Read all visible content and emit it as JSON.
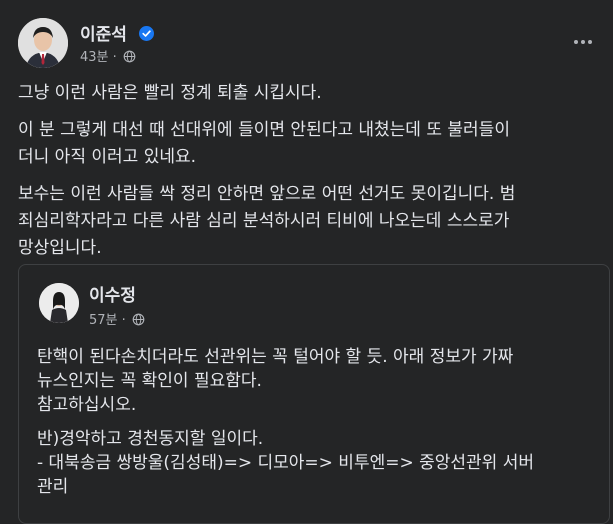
{
  "post": {
    "author": "이준석",
    "time": "43분",
    "dot": "·",
    "paragraphs": [
      [
        "그냥 이런 사람은 빨리 정계 퇴출 시킵시다."
      ],
      [
        "이 분 그렇게 대선 때 선대위에 들이면 안된다고 내쳤는데 또 불러들이",
        "더니 아직 이러고 있네요."
      ],
      [
        "보수는 이런 사람들 싹 정리 안하면 앞으로 어떤 선거도 못이깁니다. 범",
        "죄심리학자라고 다른 사람 심리 분석하시러 티비에 나오는데 스스로가",
        "망상입니다."
      ]
    ]
  },
  "shared": {
    "author": "이수정",
    "time": "57분",
    "dot": "·",
    "paragraphs": [
      [
        "탄핵이 된다손치더라도 선관위는 꼭 털어야 할 듯. 아래 정보가 가짜",
        "뉴스인지는 꼭 확인이 필요함다.",
        "참고하십시오."
      ],
      [
        "반)경악하고 경천동지할 일이다.",
        "- 대북송금 쌍방울(김성태)=> 디모아=> 비투엔=> 중앙선관위 서버",
        "관리"
      ]
    ]
  },
  "icons": {
    "verified": "verified-badge-icon",
    "globe": "globe-icon",
    "more": "more-options-icon"
  },
  "colors": {
    "background": "#242526",
    "text": "#e4e6eb",
    "secondary": "#b0b3b8",
    "verified": "#1877f2"
  }
}
